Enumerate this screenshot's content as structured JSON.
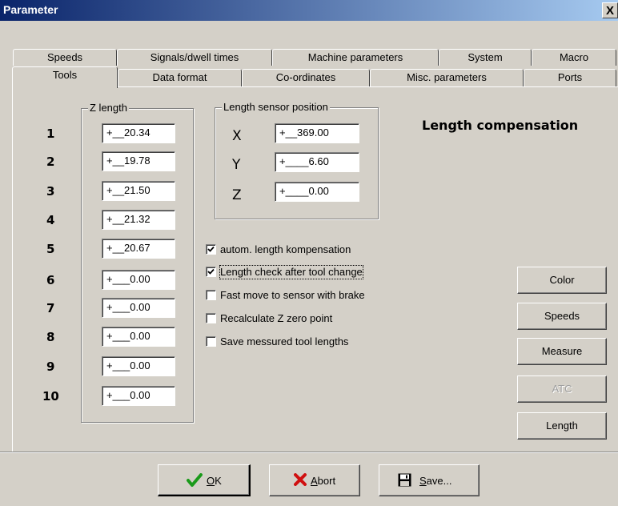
{
  "window": {
    "title": "Parameter",
    "close_glyph": "X"
  },
  "tabs": {
    "row1": [
      "Speeds",
      "Signals/dwell times",
      "Machine parameters",
      "System",
      "Macro"
    ],
    "row2": [
      "Tools",
      "Data format",
      "Co-ordinates",
      "Misc. parameters",
      "Ports"
    ],
    "active": "Tools"
  },
  "zlength": {
    "label": "Z length",
    "rows": [
      {
        "num": "1",
        "value": "+__20.34"
      },
      {
        "num": "2",
        "value": "+__19.78"
      },
      {
        "num": "3",
        "value": "+__21.50"
      },
      {
        "num": "4",
        "value": "+__21.32"
      },
      {
        "num": "5",
        "value": "+__20.67"
      },
      {
        "num": "6",
        "value": "+___0.00"
      },
      {
        "num": "7",
        "value": "+___0.00"
      },
      {
        "num": "8",
        "value": "+___0.00"
      },
      {
        "num": "9",
        "value": "+___0.00"
      },
      {
        "num": "10",
        "value": "+___0.00"
      }
    ]
  },
  "sensor": {
    "label": "Length sensor position",
    "x": {
      "axis": "X",
      "value": "+__369.00"
    },
    "y": {
      "axis": "Y",
      "value": "+____6.60"
    },
    "z": {
      "axis": "Z",
      "value": "+____0.00"
    }
  },
  "heading": "Length compensation",
  "checkboxes": [
    {
      "label": "autom. length kompensation",
      "checked": true
    },
    {
      "label": "Length check after tool change",
      "checked": true
    },
    {
      "label": "Fast move to sensor with brake",
      "checked": false
    },
    {
      "label": "Recalculate Z zero point",
      "checked": false
    },
    {
      "label": "Save messured tool lengths",
      "checked": false
    }
  ],
  "side_buttons": {
    "color": "Color",
    "speeds": "Speeds",
    "measure": "Measure",
    "atc": "ATC",
    "length": "Length"
  },
  "footer": {
    "ok": {
      "mnemonic": "O",
      "rest": "K",
      "icon": "checkmark-icon"
    },
    "abort": {
      "mnemonic": "A",
      "rest": "bort",
      "icon": "cross-icon"
    },
    "save": {
      "mnemonic": "S",
      "rest": "ave...",
      "icon": "floppy-disk-icon"
    }
  },
  "colors": {
    "title_start": "#0a246a",
    "title_end": "#a6caf0",
    "face": "#d4d0c8",
    "ok_green": "#1a9a1a",
    "abort_red": "#d01010"
  }
}
